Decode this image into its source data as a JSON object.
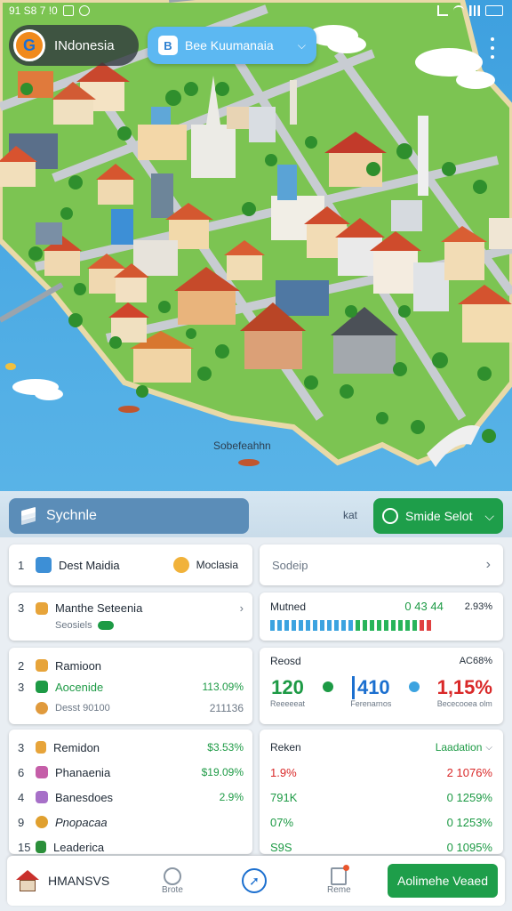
{
  "status_bar": {
    "time": "91 S8 7 !0",
    "icons": [
      "signal-icon",
      "wifi-icon",
      "bars-icon",
      "battery-icon"
    ]
  },
  "header": {
    "country_name": "INdonesia",
    "logo_letter": "G",
    "search_text": "Bee Kuumanaia",
    "search_icon": "B"
  },
  "map": {
    "label": "Sobefeahhn"
  },
  "controls": {
    "schedule_label": "Sychnle",
    "stack_label": "kat",
    "select_label": "Smide Selot"
  },
  "panels": {
    "p1": {
      "index": "1",
      "title": "Dest Maidia",
      "badge": "Moclasia"
    },
    "p2": {
      "title": "Sodeip"
    },
    "p3": {
      "index": "3",
      "title": "Manthe Seteenia",
      "subtitle": "Seosiels"
    },
    "p4": {
      "title": "Mutned",
      "value": "0 43 44",
      "pct": "2.93%"
    },
    "p5": {
      "rows": [
        {
          "index": "2",
          "label": "Ramioon",
          "value": "",
          "sub": ""
        },
        {
          "index": "3",
          "label": "Aocenide",
          "value": "113.09%",
          "sub": ""
        },
        {
          "index": "",
          "label": "Desst 90100",
          "value": "211136",
          "sub": ""
        }
      ]
    },
    "p6": {
      "title": "Reosd",
      "pct": "AC68%",
      "stats": [
        {
          "value": "120",
          "label": "Reeeeeat"
        },
        {
          "value": "410",
          "label": "Ferenarnos"
        },
        {
          "value": "1,15%",
          "label": "Bececooea olm"
        }
      ]
    },
    "p7": {
      "rows": [
        {
          "index": "3",
          "label": "Remidon",
          "value": "$3.53%"
        },
        {
          "index": "6",
          "label": "Phanaenia",
          "value": "$19.09%"
        },
        {
          "index": "4",
          "label": "Banesdoes",
          "value": "2.9%"
        },
        {
          "index": "9",
          "label": "Pnopacaa",
          "value": ""
        },
        {
          "index": "15",
          "label": "Leaderica",
          "value": ""
        }
      ]
    },
    "p8": {
      "title": "Reken",
      "right": "Laadation",
      "rows": [
        {
          "left": "1.9%",
          "right": "2 1076%"
        },
        {
          "left": "791K",
          "right": "0 1259%"
        },
        {
          "left": "07%",
          "right": "0 1253%"
        },
        {
          "left": "S9S",
          "right": "0 1095%"
        }
      ]
    }
  },
  "bottom_nav": {
    "home_label": "HMANSVS",
    "item2": "Brote",
    "item4": "Reme",
    "action_label": "Aolimehe Veaed"
  },
  "colors": {
    "accent_green": "#1e9e4a",
    "accent_blue": "#5cb8f2",
    "positive": "#1d9a45",
    "negative": "#d92828",
    "water": "#4aa8e0"
  }
}
